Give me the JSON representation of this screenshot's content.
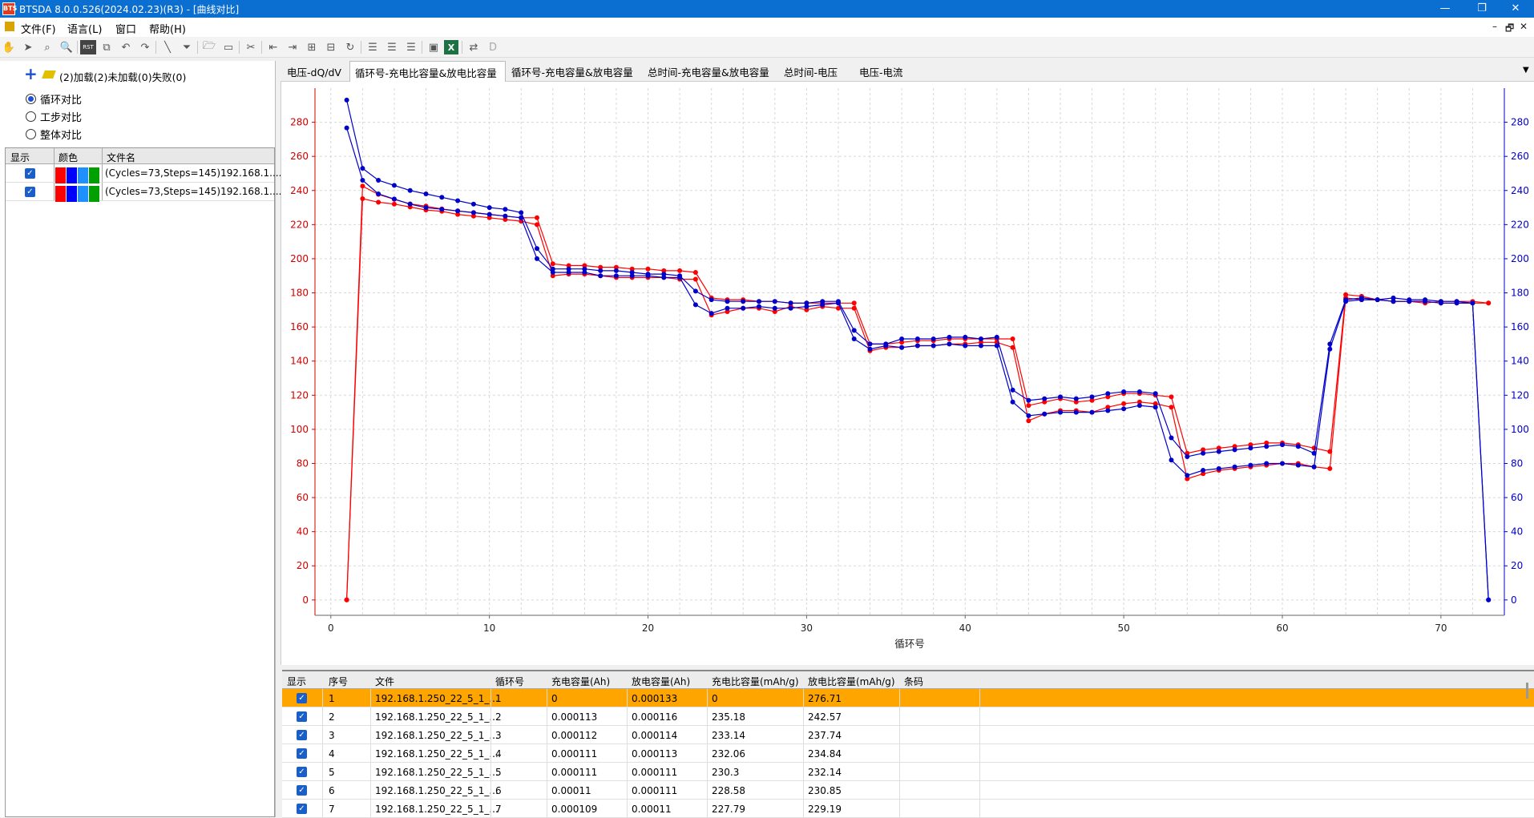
{
  "window": {
    "title": "BTSDA 8.0.0.526(2024.02.23)(R3) - [曲线对比]",
    "icon_text": "BTS",
    "controls": [
      "—",
      "❐",
      "✕"
    ]
  },
  "menu": {
    "items": [
      "文件(F)",
      "语言(L)",
      "窗口",
      "帮助(H)"
    ],
    "mdi_controls": [
      "–",
      "🗗",
      "✕"
    ]
  },
  "toolbar": {
    "icons": [
      "hand-icon",
      "pointer-icon",
      "zoom-area-icon",
      "zoom-icon",
      "rst-icon",
      "copy-chart-icon",
      "undo-icon",
      "redo-icon",
      "line-tool-icon",
      "filter-icon",
      "open-folder-icon",
      "save-copy-icon",
      "scissors-icon",
      "prev-icon",
      "next-icon",
      "merge-icon",
      "split-icon",
      "refresh-icon",
      "list-icon",
      "list-indent-icon",
      "list-outdent-icon",
      "export-image-icon",
      "excel-icon",
      "convert-icon",
      "d-icon"
    ],
    "excel_color": "#1e7145",
    "rst_label": "RST",
    "excel_label": "X",
    "d_label": "D"
  },
  "left_panel": {
    "status_text": "(2)加载(2)未加载(0)失败(0)",
    "radios": [
      {
        "label": "循环对比",
        "checked": true
      },
      {
        "label": "工步对比",
        "checked": false
      },
      {
        "label": "整体对比",
        "checked": false
      }
    ],
    "grid_headers": [
      "显示",
      "颜色",
      "文件名"
    ],
    "files": [
      {
        "checked": true,
        "name": "(Cycles=73,Steps=145)192.168.1...."
      },
      {
        "checked": true,
        "name": "(Cycles=73,Steps=145)192.168.1...."
      }
    ],
    "swatch_colors": [
      "#ff0000",
      "#0000ff",
      "#1e90ff",
      "#00a000"
    ]
  },
  "tabs": [
    {
      "label": "电压-dQ/dV",
      "active": false
    },
    {
      "label": "循环号-充电比容量&放电比容量",
      "active": true
    },
    {
      "label": "循环号-充电容量&放电容量",
      "active": false
    },
    {
      "label": "总时间-充电容量&放电容量",
      "active": false
    },
    {
      "label": "总时间-电压",
      "active": false
    },
    {
      "label": "电压-电流",
      "active": false
    }
  ],
  "chart_data": {
    "type": "line",
    "title": "",
    "xlabel": "循环号",
    "ylabel": "",
    "xlim": [
      -1,
      74
    ],
    "ylim": [
      -9,
      300
    ],
    "xticks": [
      0,
      10,
      20,
      30,
      40,
      50,
      60,
      70
    ],
    "yticks": [
      0,
      20,
      40,
      60,
      80,
      100,
      120,
      140,
      160,
      180,
      200,
      220,
      240,
      260,
      280
    ],
    "left_axis_color": "#d00000",
    "right_axis_color": "#0000cc",
    "grid": true,
    "series": [
      {
        "color": "#ff0000",
        "x": [
          1,
          2,
          3,
          4,
          5,
          6,
          7,
          8,
          9,
          10,
          11,
          12,
          13,
          14,
          15,
          16,
          17,
          18,
          19,
          20,
          21,
          22,
          23,
          24,
          25,
          26,
          27,
          28,
          29,
          30,
          31,
          32,
          33,
          34,
          35,
          36,
          37,
          38,
          39,
          40,
          41,
          42,
          43,
          44,
          45,
          46,
          47,
          48,
          49,
          50,
          51,
          52,
          53,
          54,
          55,
          56,
          57,
          58,
          59,
          60,
          61,
          62,
          63,
          64,
          65,
          66,
          67,
          68,
          69,
          70,
          71,
          72,
          73
        ],
        "values": [
          0,
          235.18,
          233.14,
          232.06,
          230.3,
          228.58,
          227.79,
          226,
          225,
          224,
          223,
          222,
          220,
          190,
          191,
          191,
          190,
          189,
          189,
          189,
          189,
          188,
          188,
          167,
          169,
          171,
          171,
          169,
          172,
          170,
          172,
          171,
          171,
          146,
          148,
          148,
          149,
          149,
          150,
          150,
          151,
          151,
          148,
          105,
          109,
          111,
          111,
          110,
          113,
          115,
          116,
          115,
          113,
          71,
          74,
          76,
          77,
          78,
          79,
          80,
          80,
          78,
          77,
          177,
          176,
          176,
          175,
          175,
          174,
          175,
          175,
          175,
          174
        ]
      },
      {
        "color": "#ff0000",
        "x": [
          1,
          2,
          3,
          4,
          5,
          6,
          7,
          8,
          9,
          10,
          11,
          12,
          13,
          14,
          15,
          16,
          17,
          18,
          19,
          20,
          21,
          22,
          23,
          24,
          25,
          26,
          27,
          28,
          29,
          30,
          31,
          32,
          33,
          34,
          35,
          36,
          37,
          38,
          39,
          40,
          41,
          42,
          43,
          44,
          45,
          46,
          47,
          48,
          49,
          50,
          51,
          52,
          53,
          54,
          55,
          56,
          57,
          58,
          59,
          60,
          61,
          62,
          63,
          64,
          65,
          66,
          67,
          68,
          69,
          70,
          71,
          72,
          73
        ],
        "values": [
          0,
          242.57,
          237.74,
          234.84,
          232.14,
          230.85,
          229.19,
          228,
          227,
          226,
          225,
          224,
          224,
          197,
          196,
          196,
          195,
          195,
          194,
          194,
          193,
          193,
          192,
          177,
          176,
          176,
          175,
          175,
          174,
          174,
          174,
          174,
          174,
          150,
          150,
          151,
          152,
          152,
          153,
          153,
          153,
          153,
          153,
          114,
          116,
          118,
          116,
          117,
          119,
          121,
          121,
          120,
          119,
          86,
          88,
          89,
          90,
          91,
          92,
          92,
          91,
          89,
          87,
          179,
          178,
          176,
          175,
          175,
          175,
          174,
          174,
          174,
          174
        ]
      },
      {
        "color": "#0000cc",
        "x": [
          1,
          2,
          3,
          4,
          5,
          6,
          7,
          8,
          9,
          10,
          11,
          12,
          13,
          14,
          15,
          16,
          17,
          18,
          19,
          20,
          21,
          22,
          23,
          24,
          25,
          26,
          27,
          28,
          29,
          30,
          31,
          32,
          33,
          34,
          35,
          36,
          37,
          38,
          39,
          40,
          41,
          42,
          43,
          44,
          45,
          46,
          47,
          48,
          49,
          50,
          51,
          52,
          53,
          54,
          55,
          56,
          57,
          58,
          59,
          60,
          61,
          62,
          63,
          64,
          65,
          66,
          67,
          68,
          69,
          70,
          71,
          72,
          73
        ],
        "values": [
          276.71,
          246,
          238,
          235,
          232,
          230,
          229,
          228,
          227,
          226,
          225,
          224,
          200,
          192,
          192,
          192,
          190,
          190,
          190,
          190,
          189,
          189,
          173,
          168,
          171,
          171,
          172,
          171,
          171,
          172,
          173,
          174,
          153,
          147,
          149,
          148,
          149,
          149,
          150,
          149,
          149,
          149,
          116,
          108,
          109,
          110,
          110,
          110,
          111,
          112,
          114,
          113,
          82,
          73,
          76,
          77,
          78,
          79,
          80,
          80,
          79,
          78,
          147,
          175,
          176,
          176,
          175,
          175,
          175,
          174,
          174,
          174,
          0
        ]
      },
      {
        "color": "#0000cc",
        "x": [
          1,
          2,
          3,
          4,
          5,
          6,
          7,
          8,
          9,
          10,
          11,
          12,
          13,
          14,
          15,
          16,
          17,
          18,
          19,
          20,
          21,
          22,
          23,
          24,
          25,
          26,
          27,
          28,
          29,
          30,
          31,
          32,
          33,
          34,
          35,
          36,
          37,
          38,
          39,
          40,
          41,
          42,
          43,
          44,
          45,
          46,
          47,
          48,
          49,
          50,
          51,
          52,
          53,
          54,
          55,
          56,
          57,
          58,
          59,
          60,
          61,
          62,
          63,
          64,
          65,
          66,
          67,
          68,
          69,
          70,
          71,
          72,
          73
        ],
        "values": [
          293,
          253,
          246,
          243,
          240,
          238,
          236,
          234,
          232,
          230,
          229,
          227,
          206,
          194,
          194,
          194,
          193,
          193,
          192,
          191,
          191,
          190,
          181,
          176,
          175,
          175,
          175,
          175,
          174,
          174,
          175,
          175,
          158,
          150,
          150,
          153,
          153,
          153,
          154,
          154,
          153,
          154,
          123,
          117,
          118,
          119,
          118,
          119,
          121,
          122,
          122,
          121,
          95,
          84,
          86,
          87,
          88,
          89,
          90,
          91,
          90,
          86,
          150,
          176,
          177,
          176,
          177,
          176,
          176,
          175,
          175,
          174,
          0
        ]
      }
    ]
  },
  "table": {
    "headers": [
      "显示",
      "序号",
      "文件",
      "循环号",
      "充电容量(Ah)",
      "放电容量(Ah)",
      "充电比容量(mAh/g)",
      "放电比容量(mAh/g)",
      "条码"
    ],
    "selected_color": "#ffa500",
    "rows": [
      {
        "checked": true,
        "seq": "1",
        "file": "192.168.1.250_22_5_1_...",
        "cycle": "1",
        "chg": "0",
        "dchg": "0.000133",
        "chg_sp": "0",
        "dchg_sp": "276.71",
        "barcode": ""
      },
      {
        "checked": true,
        "seq": "2",
        "file": "192.168.1.250_22_5_1_...",
        "cycle": "2",
        "chg": "0.000113",
        "dchg": "0.000116",
        "chg_sp": "235.18",
        "dchg_sp": "242.57",
        "barcode": ""
      },
      {
        "checked": true,
        "seq": "3",
        "file": "192.168.1.250_22_5_1_...",
        "cycle": "3",
        "chg": "0.000112",
        "dchg": "0.000114",
        "chg_sp": "233.14",
        "dchg_sp": "237.74",
        "barcode": ""
      },
      {
        "checked": true,
        "seq": "4",
        "file": "192.168.1.250_22_5_1_...",
        "cycle": "4",
        "chg": "0.000111",
        "dchg": "0.000113",
        "chg_sp": "232.06",
        "dchg_sp": "234.84",
        "barcode": ""
      },
      {
        "checked": true,
        "seq": "5",
        "file": "192.168.1.250_22_5_1_...",
        "cycle": "5",
        "chg": "0.000111",
        "dchg": "0.000111",
        "chg_sp": "230.3",
        "dchg_sp": "232.14",
        "barcode": ""
      },
      {
        "checked": true,
        "seq": "6",
        "file": "192.168.1.250_22_5_1_...",
        "cycle": "6",
        "chg": "0.00011",
        "dchg": "0.000111",
        "chg_sp": "228.58",
        "dchg_sp": "230.85",
        "barcode": ""
      },
      {
        "checked": true,
        "seq": "7",
        "file": "192.168.1.250_22_5_1_...",
        "cycle": "7",
        "chg": "0.000109",
        "dchg": "0.00011",
        "chg_sp": "227.79",
        "dchg_sp": "229.19",
        "barcode": ""
      }
    ]
  }
}
